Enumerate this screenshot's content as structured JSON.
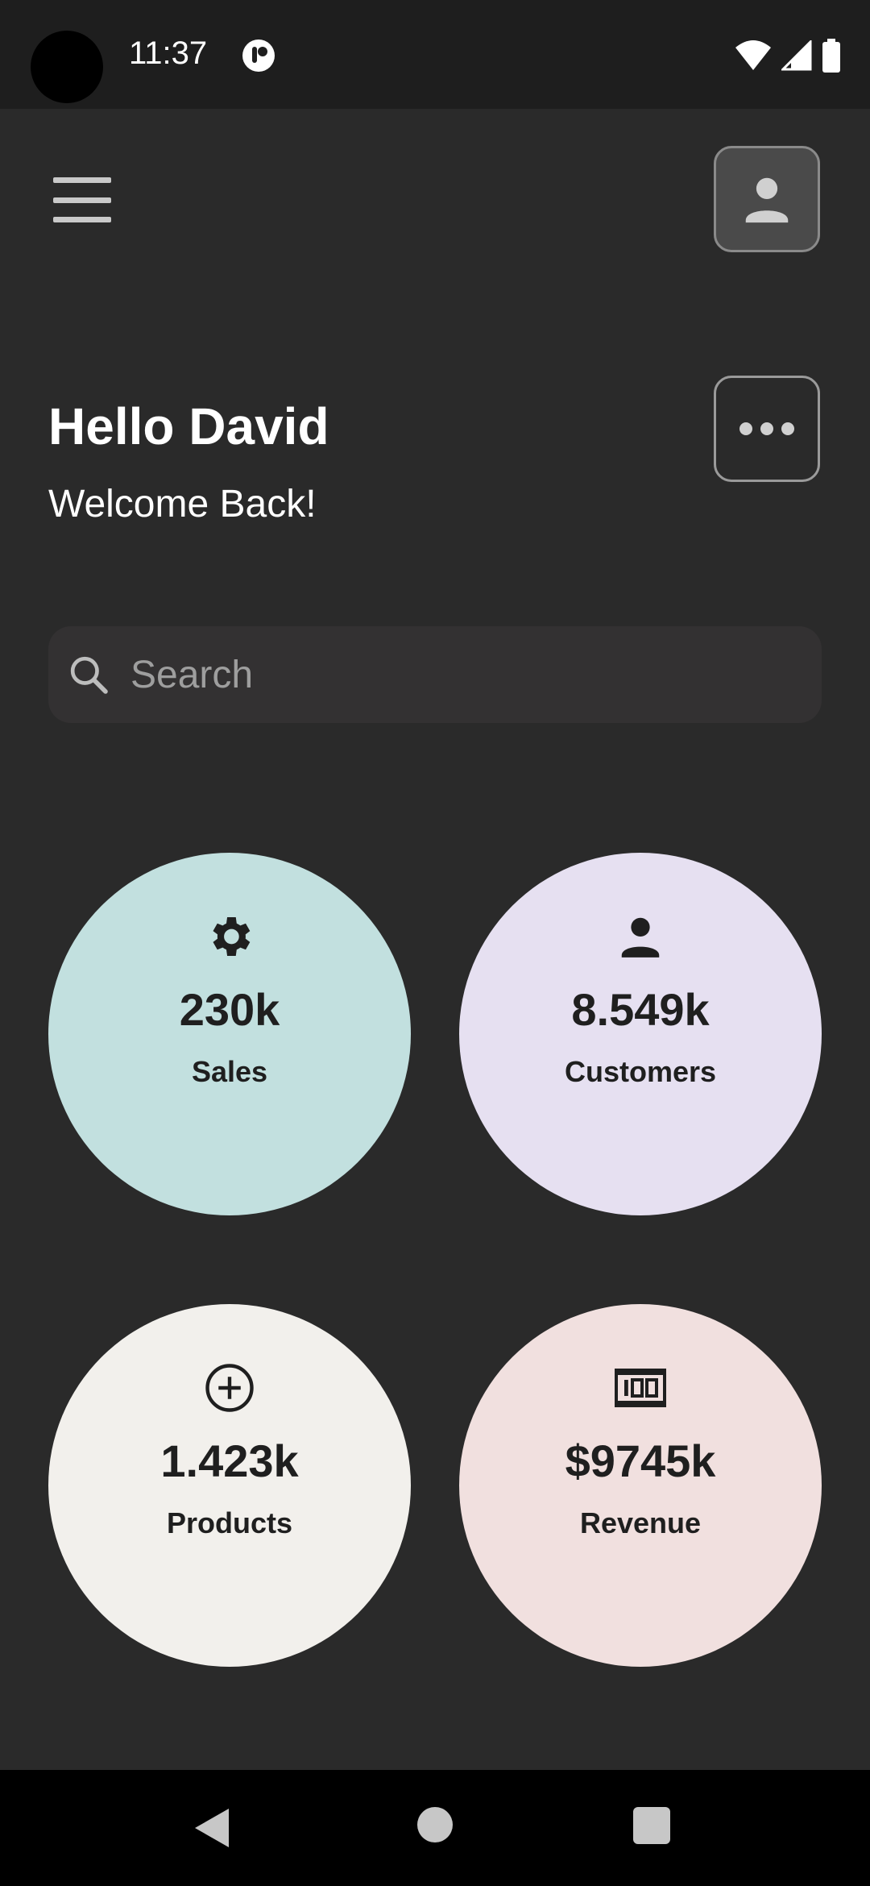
{
  "status_bar": {
    "time": "11:37",
    "icons": [
      "wifi-icon",
      "signal-icon",
      "battery-icon"
    ]
  },
  "header": {
    "menu_icon": "hamburger-menu-icon",
    "profile_icon": "person-icon"
  },
  "greeting": {
    "title": "Hello David",
    "subtitle": "Welcome Back!",
    "more_icon": "more-horizontal-icon"
  },
  "search": {
    "placeholder": "Search",
    "value": ""
  },
  "stats": [
    {
      "icon": "gear-icon",
      "value": "230k",
      "label": "Sales",
      "color": "#c2e0df"
    },
    {
      "icon": "person-icon",
      "value": "8.549k",
      "label": "Customers",
      "color": "#e6e0f1"
    },
    {
      "icon": "add-circle-icon",
      "value": "1.423k",
      "label": "Products",
      "color": "#f2f0ec"
    },
    {
      "icon": "money-icon",
      "value": "$9745k",
      "label": "Revenue",
      "color": "#f1e0df"
    }
  ],
  "colors": {
    "background": "#2a2a2a",
    "status_bar": "#1e1e1e",
    "search_bg": "#333132"
  }
}
